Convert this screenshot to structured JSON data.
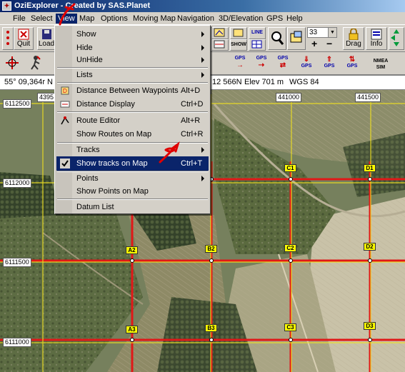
{
  "window": {
    "title": "OziExplorer - Created by SAS.Planet"
  },
  "menubar": [
    "File",
    "Select",
    "View",
    "Map",
    "Options",
    "Moving Map",
    "Navigation",
    "3D/Elevation",
    "GPS",
    "Help"
  ],
  "toolbar": {
    "quit": "Quit",
    "load": "Load",
    "zoom_value": "33",
    "drag": "Drag",
    "info": "Info",
    "line_icon_text": "LINE",
    "show_icon_text": "SHOW",
    "gps_icon_text": "GPS",
    "nmea_sim": "NMEA SIM"
  },
  "status": {
    "lat": "55° 09,364r N",
    "coords": "12 566N",
    "elev": "Elev 701 m",
    "datum": "WGS 84"
  },
  "view_menu": [
    {
      "label": "Show",
      "submenu": true
    },
    {
      "label": "Hide",
      "submenu": true
    },
    {
      "label": "UnHide",
      "submenu": true
    },
    {
      "label": "Lists",
      "submenu": true
    },
    {
      "label": "Distance Between Waypoints",
      "shortcut": "Alt+D"
    },
    {
      "label": "Distance Display",
      "shortcut": "Ctrl+D"
    },
    {
      "label": "Route Editor",
      "shortcut": "Alt+R"
    },
    {
      "label": "Show Routes on Map",
      "shortcut": "Ctrl+R"
    },
    {
      "label": "Tracks",
      "submenu": true
    },
    {
      "label": "Show tracks on Map",
      "shortcut": "Ctrl+T",
      "checked": true,
      "highlighted": true
    },
    {
      "label": "Points",
      "submenu": true
    },
    {
      "label": "Show Points on Map"
    },
    {
      "label": "Datum List"
    }
  ],
  "map": {
    "easting_labels": [
      "4395",
      "441000",
      "441500"
    ],
    "northing_labels": [
      "6112500",
      "6112000",
      "6111500",
      "6111000"
    ],
    "grid_cells": [
      "C1",
      "D1",
      "A2",
      "B2",
      "C2",
      "D2",
      "A3",
      "B3",
      "C3",
      "D3"
    ],
    "grid_color": "#e01818"
  },
  "annotation": {
    "color": "#e00000"
  }
}
